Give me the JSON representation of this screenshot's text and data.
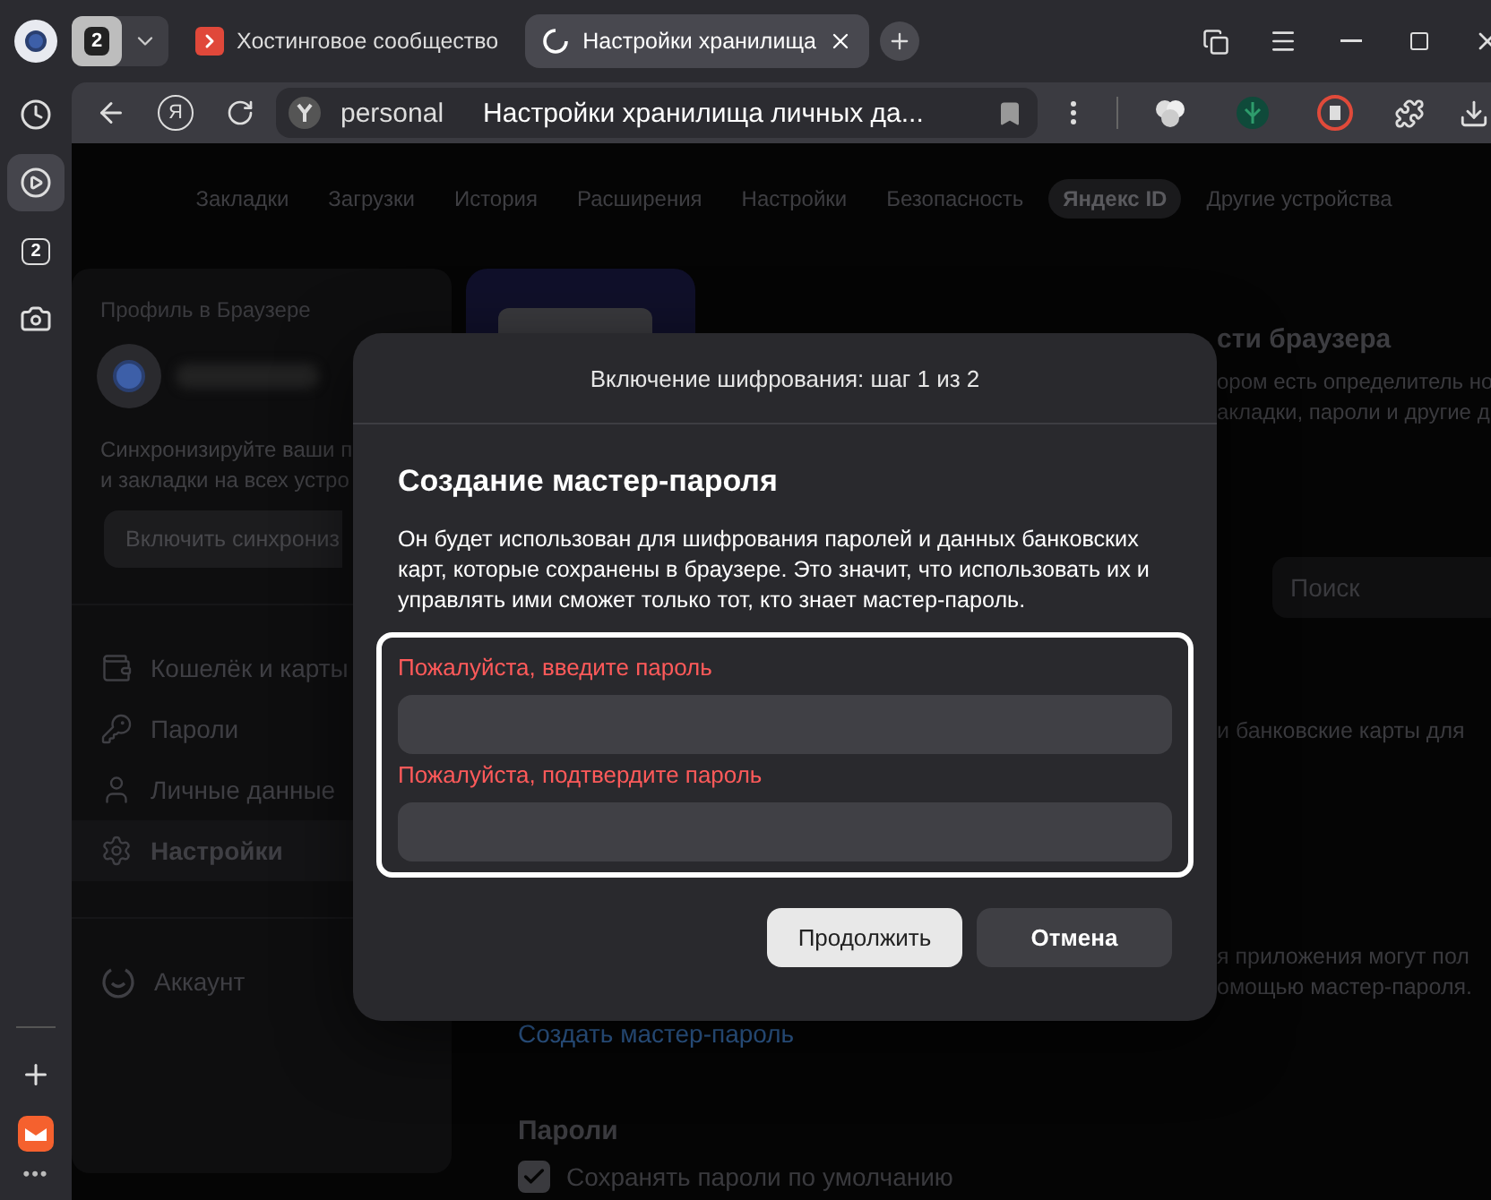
{
  "tab_strip": {
    "group_count": "2",
    "tabs": [
      {
        "title": "Хостинговое сообщество",
        "kind": "site",
        "selected": false
      },
      {
        "title": "Настройки хранилища",
        "kind": "loading",
        "selected": true
      }
    ]
  },
  "address_bar": {
    "yandex_button": "Я",
    "domain": "personal",
    "page_title": "Настройки хранилища личных да..."
  },
  "rail": {
    "items": [
      {
        "kind": "history",
        "selected": false
      },
      {
        "kind": "video",
        "selected": true
      },
      {
        "kind": "tabs",
        "label": "2",
        "selected": false
      },
      {
        "kind": "screenshot",
        "selected": false
      }
    ],
    "more": "•••"
  },
  "nav": [
    {
      "label": "Закладки",
      "selected": false
    },
    {
      "label": "Загрузки",
      "selected": false
    },
    {
      "label": "История",
      "selected": false
    },
    {
      "label": "Расширения",
      "selected": false
    },
    {
      "label": "Настройки",
      "selected": false
    },
    {
      "label": "Безопасность",
      "selected": false
    },
    {
      "label": "Яндекс ID",
      "selected": true
    },
    {
      "label": "Другие устройства",
      "selected": false
    }
  ],
  "profile": {
    "heading": "Профиль в Браузере",
    "sync_text": [
      "Синхронизируйте ваши п",
      "и закладки на всех устро"
    ],
    "sync_button": "Включить синхрониз"
  },
  "sidebar": {
    "items": [
      {
        "label": "Кошелёк и карты",
        "kind": "wallet",
        "selected": false
      },
      {
        "label": "Пароли",
        "kind": "key",
        "selected": false
      },
      {
        "label": "Личные данные",
        "kind": "person",
        "selected": false
      },
      {
        "label": "Настройки",
        "kind": "gear",
        "selected": true
      }
    ],
    "account": "Аккаунт"
  },
  "banner": {
    "heading": "сти браузера",
    "lines": [
      "ором есть определитель но",
      "акладки, пароли и другие д"
    ]
  },
  "search": {
    "placeholder": "Поиск"
  },
  "fragments": [
    [
      "и банковские карты для"
    ],
    [
      "я приложения могут пол",
      "омощью мастер-пароля."
    ]
  ],
  "create_link": "Создать мастер-пароль",
  "passwords": {
    "title": "Пароли",
    "options": [
      {
        "label": "Сохранять пароли по умолчанию",
        "checked": true
      }
    ]
  },
  "dialog": {
    "header": "Включение шифрования: шаг 1 из 2",
    "title": "Создание мастер-пароля",
    "text": "Он будет использован для шифрования паролей и данных банковских карт, которые сохранены в браузере. Это значит, что использовать их и управлять ими сможет только тот, кто знает мастер-пароль.",
    "fields": [
      {
        "label": "Пожалуйста, введите пароль",
        "error": true
      },
      {
        "label": "Пожалуйста, подтвердите пароль",
        "error": true
      }
    ],
    "buttons": [
      {
        "label": "Продолжить",
        "kind": "primary"
      },
      {
        "label": "Отмена",
        "kind": "secondary"
      }
    ]
  }
}
